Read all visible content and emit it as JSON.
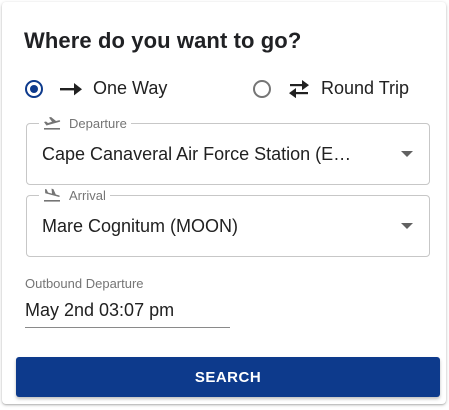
{
  "title": "Where do you want to go?",
  "trip_type": {
    "options": [
      {
        "label": "One Way",
        "selected": true,
        "icon": "arrow-right-icon"
      },
      {
        "label": "Round Trip",
        "selected": false,
        "icon": "swap-horizontal-icon"
      }
    ]
  },
  "departure": {
    "label": "Departure",
    "icon": "flight-takeoff-icon",
    "value": "Cape Canaveral Air Force Station (E…"
  },
  "arrival": {
    "label": "Arrival",
    "icon": "flight-land-icon",
    "value": "Mare Cognitum (MOON)"
  },
  "outbound": {
    "label": "Outbound Departure",
    "value": "May 2nd 03:07 pm"
  },
  "search_label": "SEARCH",
  "colors": {
    "primary": "#0d3a8c",
    "border": "#c7c7c7",
    "muted_text": "#757575"
  }
}
